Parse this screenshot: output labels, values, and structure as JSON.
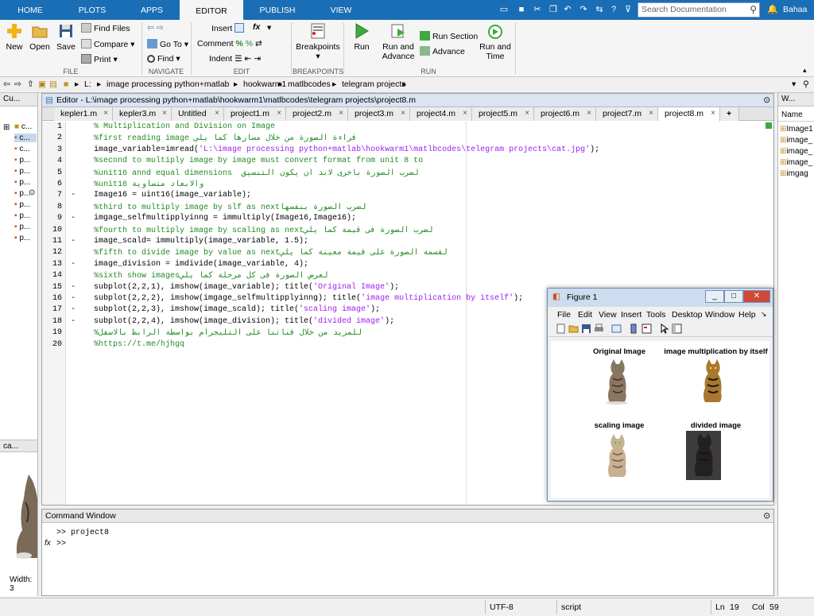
{
  "tabs": [
    "HOME",
    "PLOTS",
    "APPS",
    "EDITOR",
    "PUBLISH",
    "VIEW"
  ],
  "search": {
    "placeholder": "Search Documentation"
  },
  "user": "Bahaa",
  "ribbon": {
    "new": "New",
    "open": "Open",
    "save": "Save",
    "find_files": "Find Files",
    "compare": "Compare",
    "print": "Print",
    "go_to": "Go To",
    "find": "Find",
    "insert": "Insert",
    "comment": "Comment",
    "indent": "Indent",
    "breakpoints": "Breakpoints",
    "run": "Run",
    "run_and_advance": "Run and Advance",
    "run_section": "Run Section",
    "advance": "Advance",
    "run_and_time": "Run and Time",
    "groups": {
      "file": "FILE",
      "navigate": "NAVIGATE",
      "edit": "EDIT",
      "breakpoints": "BREAKPOINTS",
      "run": "RUN"
    }
  },
  "path": [
    "L:",
    "image processing python+matlab",
    "hookwarm1",
    "matlbcodes",
    "telegram projects"
  ],
  "left_panel": {
    "title": "Cu...",
    "items": [
      "c...",
      "c...",
      "c...",
      "p...",
      "p...",
      "p...",
      "p...",
      "p...",
      "p...",
      "p...",
      "p..."
    ],
    "preview_title": "ca...",
    "width_label": "Width: 3"
  },
  "editor": {
    "title": "Editor - L:\\image processing python+matlab\\hookwarm1\\matlbcodes\\telegram projects\\project8.m",
    "tabs": [
      "kepler1.m",
      "kepler3.m",
      "Untitled",
      "project1.m",
      "project2.m",
      "project3.m",
      "project4.m",
      "project5.m",
      "project6.m",
      "project7.m",
      "project8.m"
    ],
    "active_tab": "project8.m",
    "lines": [
      [
        {
          "t": "  % Multiplication and Division on Image",
          "c": "com"
        }
      ],
      [
        {
          "t": "  %first reading image قراءة الصورة من خلال مسارها كما يلي",
          "c": "com"
        }
      ],
      [
        {
          "t": "  image_variable=imread(",
          "c": ""
        },
        {
          "t": "'L:\\image processing python+matlab\\hookwarm1\\matlbcodes\\telegram projects\\cat.jpg'",
          "c": "str"
        },
        {
          "t": ");",
          "c": ""
        }
      ],
      [
        {
          "t": "  %second to multiply image by image must convert format from unit 8 to",
          "c": "com"
        }
      ],
      [
        {
          "t": "  %unit16 annd equal dimensions  لضرب الصورة باخرى لابد ان يكون التنسيق",
          "c": "com"
        }
      ],
      [
        {
          "t": "  %unit16 والابعاد متساوية",
          "c": "com"
        }
      ],
      [
        {
          "t": "  Image16 = uint16(image_variable);",
          "c": ""
        }
      ],
      [
        {
          "t": "  %third to multiply image by slf as nextلضرب الصورة بنفسها",
          "c": "com"
        }
      ],
      [
        {
          "t": "  imgage_selfmultipplyinng = immultiply(Image16,Image16);",
          "c": ""
        }
      ],
      [
        {
          "t": "  %fourth to multiply image by scaling as nextلضرب الصورة فى قيمة كما يلي",
          "c": "com"
        }
      ],
      [
        {
          "t": "  image_scald= immultiply(image_variable, 1.5);",
          "c": ""
        }
      ],
      [
        {
          "t": "  %fifth to divide image by value as nextلقسمة الصورة على قيمة معينة كما يلي",
          "c": "com"
        }
      ],
      [
        {
          "t": "  image_division = imdivide(image_variable, 4);",
          "c": ""
        }
      ],
      [
        {
          "t": "  %sixth show imagesلعرض الصورة فى كل مرحلة كما يلي",
          "c": "com"
        }
      ],
      [
        {
          "t": "  subplot(2,2,1), imshow(image_variable); title(",
          "c": ""
        },
        {
          "t": "'Original Image'",
          "c": "str"
        },
        {
          "t": ");",
          "c": ""
        }
      ],
      [
        {
          "t": "  subplot(2,2,2), imshow(imgage_selfmultipplyinng); title(",
          "c": ""
        },
        {
          "t": "'image multiplication by itself'",
          "c": "str"
        },
        {
          "t": ");",
          "c": ""
        }
      ],
      [
        {
          "t": "  subplot(2,2,3), imshow(image_scald); title(",
          "c": ""
        },
        {
          "t": "'scaling image'",
          "c": "str"
        },
        {
          "t": ");",
          "c": ""
        }
      ],
      [
        {
          "t": "  subplot(2,2,4), imshow(image_division); title(",
          "c": ""
        },
        {
          "t": "'divided image'",
          "c": "str"
        },
        {
          "t": ");",
          "c": ""
        }
      ],
      [
        {
          "t": "  %للمزيد من خلال قناتنا على التليجرام بواسطة الرابط بالاسفل",
          "c": "com"
        }
      ],
      [
        {
          "t": "  %https://t.me/hjhgq",
          "c": "com"
        }
      ]
    ],
    "colors": {
      "comment": "#228b22",
      "string": "#a020f0"
    }
  },
  "figure": {
    "title": "Figure 1",
    "menu": [
      "File",
      "Edit",
      "View",
      "Insert",
      "Tools",
      "Desktop",
      "Window",
      "Help"
    ],
    "subplots": [
      "Original Image",
      "image multiplication by itself",
      "scaling image",
      "divided image"
    ]
  },
  "command_window": {
    "title": "Command Window",
    "lines": [
      ">> project8",
      ">>"
    ]
  },
  "workspace": {
    "title": "W...",
    "name_header": "Name",
    "items": [
      "Image1",
      "image_",
      "image_",
      "image_",
      "imgag"
    ]
  },
  "status": {
    "encoding": "UTF-8",
    "type": "script",
    "ln_label": "Ln",
    "ln": "19",
    "col_label": "Col",
    "col": "59"
  }
}
